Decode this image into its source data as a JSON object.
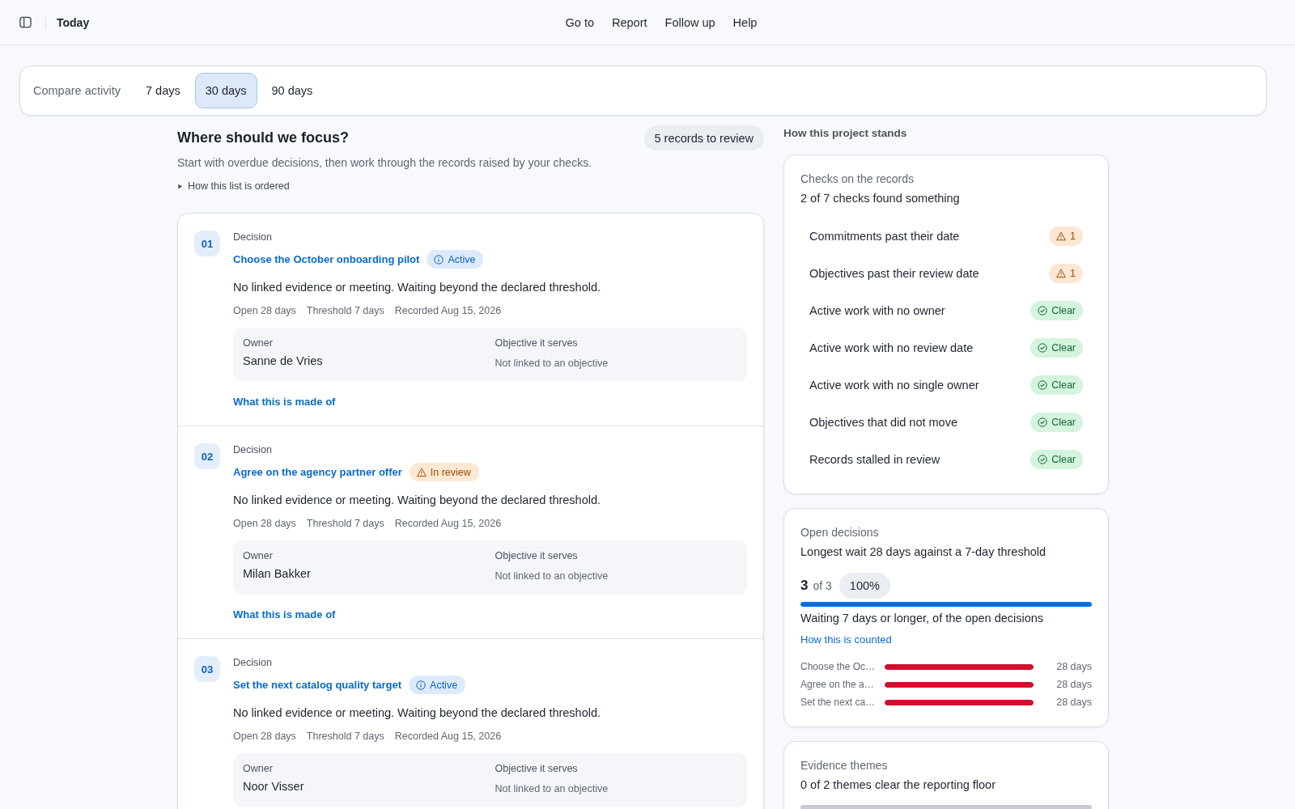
{
  "topbar": {
    "title": "Today",
    "nav": [
      {
        "label": "Go to"
      },
      {
        "label": "Report"
      },
      {
        "label": "Follow up"
      },
      {
        "label": "Help"
      }
    ]
  },
  "compare": {
    "label": "Compare activity",
    "tabs": [
      {
        "label": "7 days",
        "selected": false
      },
      {
        "label": "30 days",
        "selected": true
      },
      {
        "label": "90 days",
        "selected": false
      }
    ]
  },
  "focus": {
    "title": "Where should we focus?",
    "badge": "5 records to review",
    "subtitle": "Start with overdue decisions, then work through the records raised by your checks.",
    "disclosure": {
      "label": "How this list is ordered",
      "expanded": false
    },
    "items": [
      {
        "number": "01",
        "type": "Decision",
        "title": "Choose the October onboarding pilot",
        "status": {
          "kind": "active",
          "label": "Active"
        },
        "description": "No linked evidence or meeting. Waiting beyond the declared threshold.",
        "meta": [
          "Open 28 days",
          "Threshold 7 days",
          "Recorded Aug 15, 2026"
        ],
        "owner": {
          "label": "Owner",
          "value": "Sanne de Vries"
        },
        "objective": {
          "label": "Objective it serves",
          "value": "Not linked to an objective"
        },
        "link": "What this is made of"
      },
      {
        "number": "02",
        "type": "Decision",
        "title": "Agree on the agency partner offer",
        "status": {
          "kind": "review",
          "label": "In review"
        },
        "description": "No linked evidence or meeting. Waiting beyond the declared threshold.",
        "meta": [
          "Open 28 days",
          "Threshold 7 days",
          "Recorded Aug 15, 2026"
        ],
        "owner": {
          "label": "Owner",
          "value": "Milan Bakker"
        },
        "objective": {
          "label": "Objective it serves",
          "value": "Not linked to an objective"
        },
        "link": "What this is made of"
      },
      {
        "number": "03",
        "type": "Decision",
        "title": "Set the next catalog quality target",
        "status": {
          "kind": "active",
          "label": "Active"
        },
        "description": "No linked evidence or meeting. Waiting beyond the declared threshold.",
        "meta": [
          "Open 28 days",
          "Threshold 7 days",
          "Recorded Aug 15, 2026"
        ],
        "owner": {
          "label": "Owner",
          "value": "Noor Visser"
        },
        "objective": {
          "label": "Objective it serves",
          "value": "Not linked to an objective"
        }
      }
    ]
  },
  "project": {
    "heading": "How this project stands",
    "checks": {
      "title": "Checks on the records",
      "summary": "2 of 7 checks found something",
      "rows": [
        {
          "label": "Commitments past their date",
          "result": {
            "kind": "warning",
            "text": "1"
          }
        },
        {
          "label": "Objectives past their review date",
          "result": {
            "kind": "warning",
            "text": "1"
          }
        },
        {
          "label": "Active work with no owner",
          "result": {
            "kind": "clear",
            "text": "Clear"
          }
        },
        {
          "label": "Active work with no review date",
          "result": {
            "kind": "clear",
            "text": "Clear"
          }
        },
        {
          "label": "Active work with no single owner",
          "result": {
            "kind": "clear",
            "text": "Clear"
          }
        },
        {
          "label": "Objectives that did not move",
          "result": {
            "kind": "clear",
            "text": "Clear"
          }
        },
        {
          "label": "Records stalled in review",
          "result": {
            "kind": "clear",
            "text": "Clear"
          }
        }
      ]
    },
    "open_decisions": {
      "title": "Open decisions",
      "summary": "Longest wait 28 days against a 7-day threshold",
      "count": "3",
      "of": "of 3",
      "percent": "100%",
      "level": 1,
      "caption": "Waiting 7 days or longer, of the open decisions",
      "link": "How this is counted",
      "waits": [
        {
          "label": "Choose the Oc…",
          "level": 1,
          "value": "28 days"
        },
        {
          "label": "Agree on the a…",
          "level": 1,
          "value": "28 days"
        },
        {
          "label": "Set the next ca…",
          "level": 1,
          "value": "28 days"
        }
      ]
    },
    "evidence_themes": {
      "title": "Evidence themes",
      "summary": "0 of 2 themes clear the reporting floor",
      "level": 0
    }
  }
}
